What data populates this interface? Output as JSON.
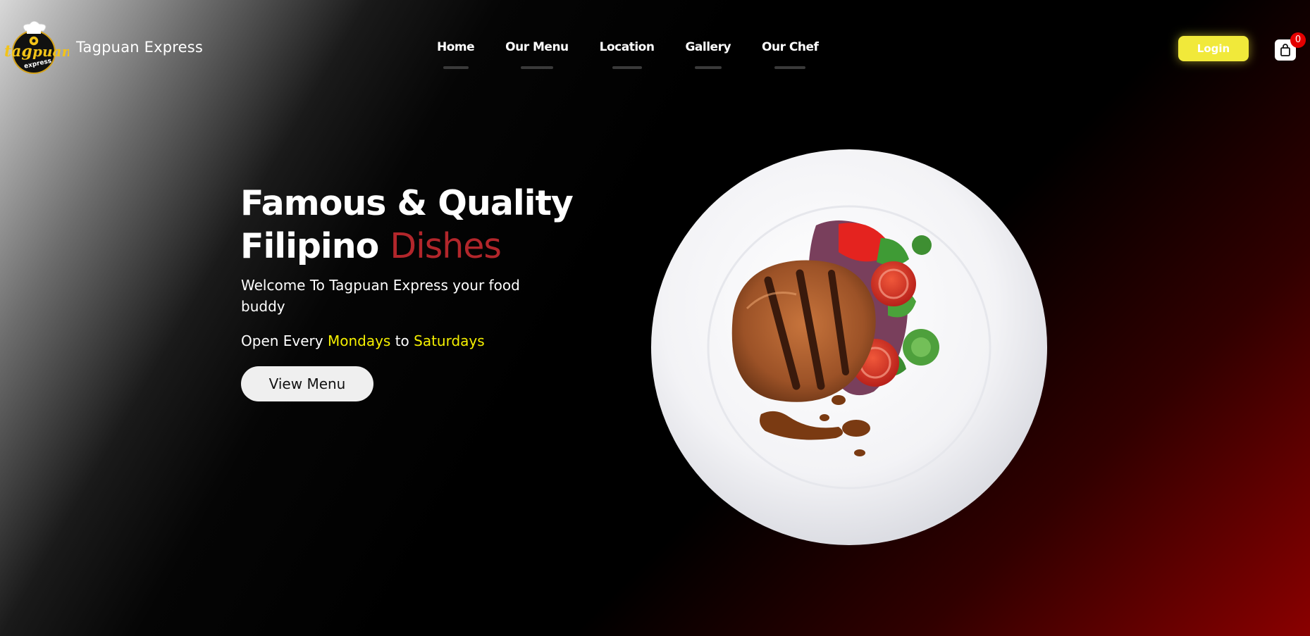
{
  "brand": {
    "name": "Tagpuan Express",
    "logo_text_top": "tag",
    "logo_text_mid": "puan",
    "logo_text_sub": "express"
  },
  "nav": {
    "items": [
      {
        "label": "Home"
      },
      {
        "label": "Our Menu"
      },
      {
        "label": "Location"
      },
      {
        "label": "Gallery"
      },
      {
        "label": "Our Chef"
      }
    ]
  },
  "header": {
    "login_label": "Login",
    "cart_count": "0"
  },
  "hero": {
    "title_line1": "Famous & Quality",
    "title_line2_prefix": "Filipino ",
    "title_line2_accent": "Dishes",
    "welcome": "Welcome To Tagpuan Express your food buddy",
    "hours_prefix": "Open Every ",
    "hours_day1": "Mondays",
    "hours_mid": " to ",
    "hours_day2": "Saturdays",
    "cta_label": "View Menu"
  },
  "colors": {
    "accent_red": "#b2262b",
    "highlight_yellow": "#f5f000",
    "login_yellow": "#f1e93a",
    "badge_red": "#e40000"
  },
  "icons": {
    "cart": "shopping-bag-icon",
    "logo": "chef-hat-logo-icon",
    "hero_image": "grilled-pork-plate-image"
  }
}
